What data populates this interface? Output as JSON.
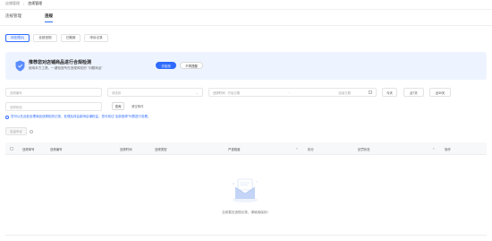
{
  "breadcrumb": {
    "parent": "店铺管理",
    "separator": "/",
    "current": "违规管理"
  },
  "main_tabs": [
    {
      "label": "违规管理",
      "active": false
    },
    {
      "label": "违规",
      "active": true
    }
  ],
  "sub_tabs": [
    {
      "label": "待处理(0)",
      "active": true
    },
    {
      "label": "全部违规",
      "active": false
    },
    {
      "label": "已撤销",
      "active": false
    },
    {
      "label": "申诉记录",
      "active": false
    }
  ],
  "banner": {
    "title": "推荐您对店铺商品进行合规检测",
    "desc": "使用本方工具，一键检查所在违规风险的 \"问题商品\"",
    "primary_button": "去检测",
    "secondary_button": "不再提醒"
  },
  "filters": {
    "order_no_placeholder": "违规编号",
    "type_placeholder": "请选择",
    "time_label": "违规时间",
    "start_placeholder": "开始日期",
    "end_placeholder": "结束日期",
    "date_sep": "→",
    "product_placeholder": "违规商品",
    "quick": [
      "今天",
      "近7天",
      "近30天"
    ],
    "search_button": "查询",
    "reset_link": "清空条件"
  },
  "notice": "您可以在此处处理商品违规相关记录，处理后将会影响店铺权益，您可前往\"全部违规\"列表进行查看。",
  "batch_button": "批量申诉",
  "table": {
    "columns": [
      "违规单号",
      "违规编号",
      "违规时间",
      "违规类型",
      "严重程度",
      "扣分",
      "处罚状态",
      "操作"
    ]
  },
  "empty_text": "当前暂无违规记录，请继续保持！",
  "colors": {
    "accent": "#2f6bff",
    "banner_bg": "#eef4ff"
  }
}
